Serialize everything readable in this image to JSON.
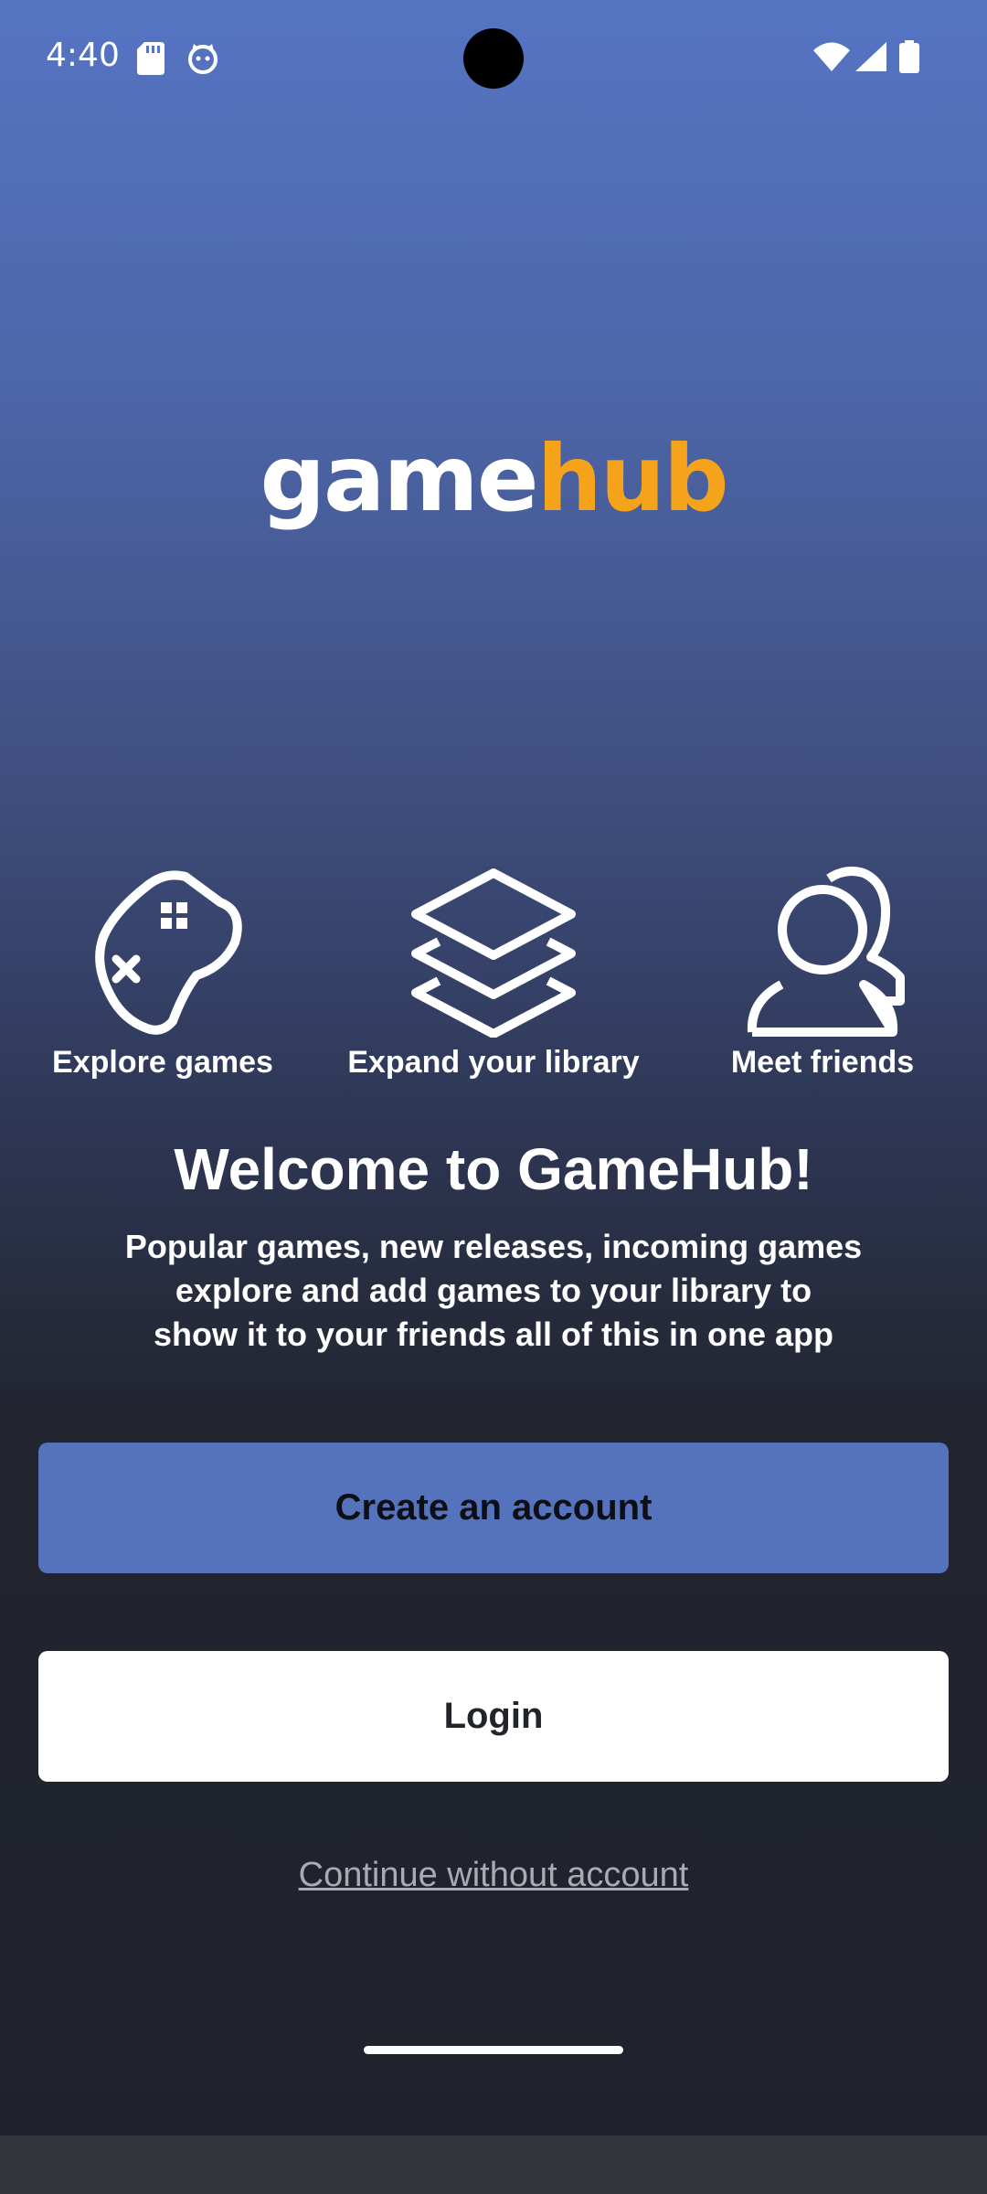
{
  "status_bar": {
    "time": "4:40",
    "icons": [
      "sd-card-icon",
      "cat-icon",
      "wifi-icon",
      "signal-icon",
      "battery-icon"
    ]
  },
  "logo": {
    "part1": "game",
    "part2": "hub",
    "colors": {
      "game": "#ffffff",
      "hub": "#f5a31b"
    }
  },
  "features": [
    {
      "label": "Explore games",
      "icon": "gamepad-icon"
    },
    {
      "label": "Expand your library",
      "icon": "layers-icon"
    },
    {
      "label": "Meet friends",
      "icon": "friends-icon"
    }
  ],
  "welcome": {
    "title": "Welcome to GameHub!",
    "line1": "Popular games, new releases, incoming games",
    "line2": "explore and add games to your library to",
    "line3": "show it to your friends all of this in one app"
  },
  "actions": {
    "create_account": "Create an account",
    "login": "Login",
    "continue_without": "Continue without account"
  },
  "colors": {
    "accent": "#5573bd",
    "background_dark": "#1f222b"
  }
}
